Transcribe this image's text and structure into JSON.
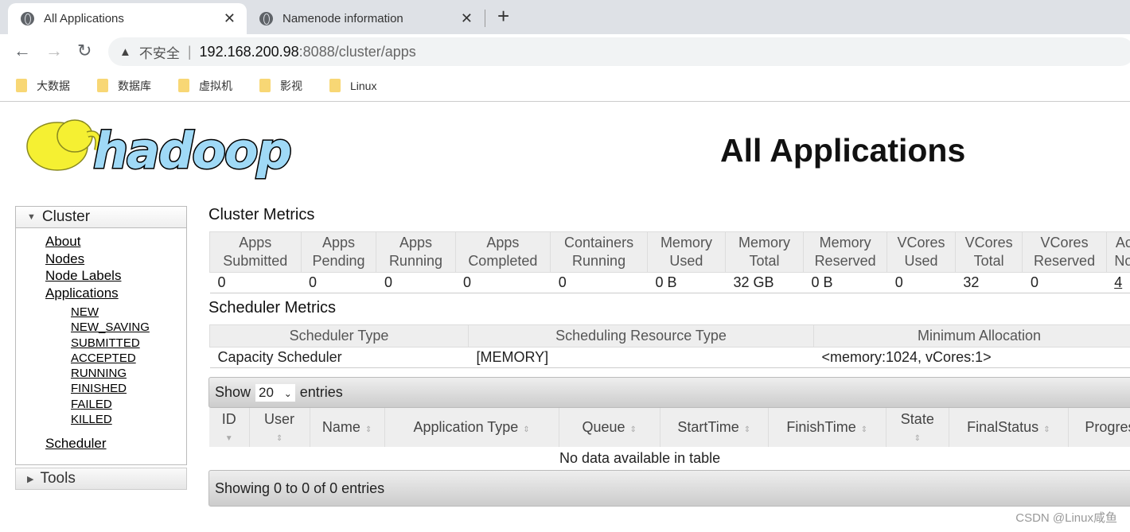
{
  "browser": {
    "tabs": [
      {
        "title": "All Applications",
        "active": true
      },
      {
        "title": "Namenode information",
        "active": false
      }
    ],
    "new_tab": "+",
    "security": "不安全",
    "url_host": "192.168.200.98",
    "url_path": ":8088/cluster/apps",
    "bookmarks": [
      "大数据",
      "数据库",
      "虚拟机",
      "影视",
      "Linux"
    ]
  },
  "header": {
    "logo": "hadoop",
    "title": "All Applications"
  },
  "sidebar": {
    "cluster": "Cluster",
    "links": [
      "About",
      "Nodes",
      "Node Labels",
      "Applications"
    ],
    "app_states": [
      "NEW",
      "NEW_SAVING",
      "SUBMITTED",
      "ACCEPTED",
      "RUNNING",
      "FINISHED",
      "FAILED",
      "KILLED"
    ],
    "scheduler": "Scheduler",
    "tools": "Tools"
  },
  "cluster_metrics": {
    "title": "Cluster Metrics",
    "headers": [
      [
        "Apps",
        "Submitted"
      ],
      [
        "Apps",
        "Pending"
      ],
      [
        "Apps",
        "Running"
      ],
      [
        "Apps",
        "Completed"
      ],
      [
        "Containers",
        "Running"
      ],
      [
        "Memory",
        "Used"
      ],
      [
        "Memory",
        "Total"
      ],
      [
        "Memory",
        "Reserved"
      ],
      [
        "VCores",
        "Used"
      ],
      [
        "VCores",
        "Total"
      ],
      [
        "VCores",
        "Reserved"
      ],
      [
        "Active",
        "Nodes"
      ]
    ],
    "values": [
      "0",
      "0",
      "0",
      "0",
      "0",
      "0 B",
      "32 GB",
      "0 B",
      "0",
      "32",
      "0",
      "4"
    ]
  },
  "scheduler_metrics": {
    "title": "Scheduler Metrics",
    "headers": [
      "Scheduler Type",
      "Scheduling Resource Type",
      "Minimum Allocation"
    ],
    "values": [
      "Capacity Scheduler",
      "[MEMORY]",
      "<memory:1024, vCores:1>"
    ]
  },
  "apps_table": {
    "show": "Show",
    "page_size": "20",
    "entries": "entries",
    "columns": [
      "ID",
      "User",
      "Name",
      "Application Type",
      "Queue",
      "StartTime",
      "FinishTime",
      "State",
      "FinalStatus",
      "Progress"
    ],
    "empty": "No data available in table",
    "info": "Showing 0 to 0 of 0 entries"
  },
  "watermark": "CSDN @Linux咸鱼"
}
